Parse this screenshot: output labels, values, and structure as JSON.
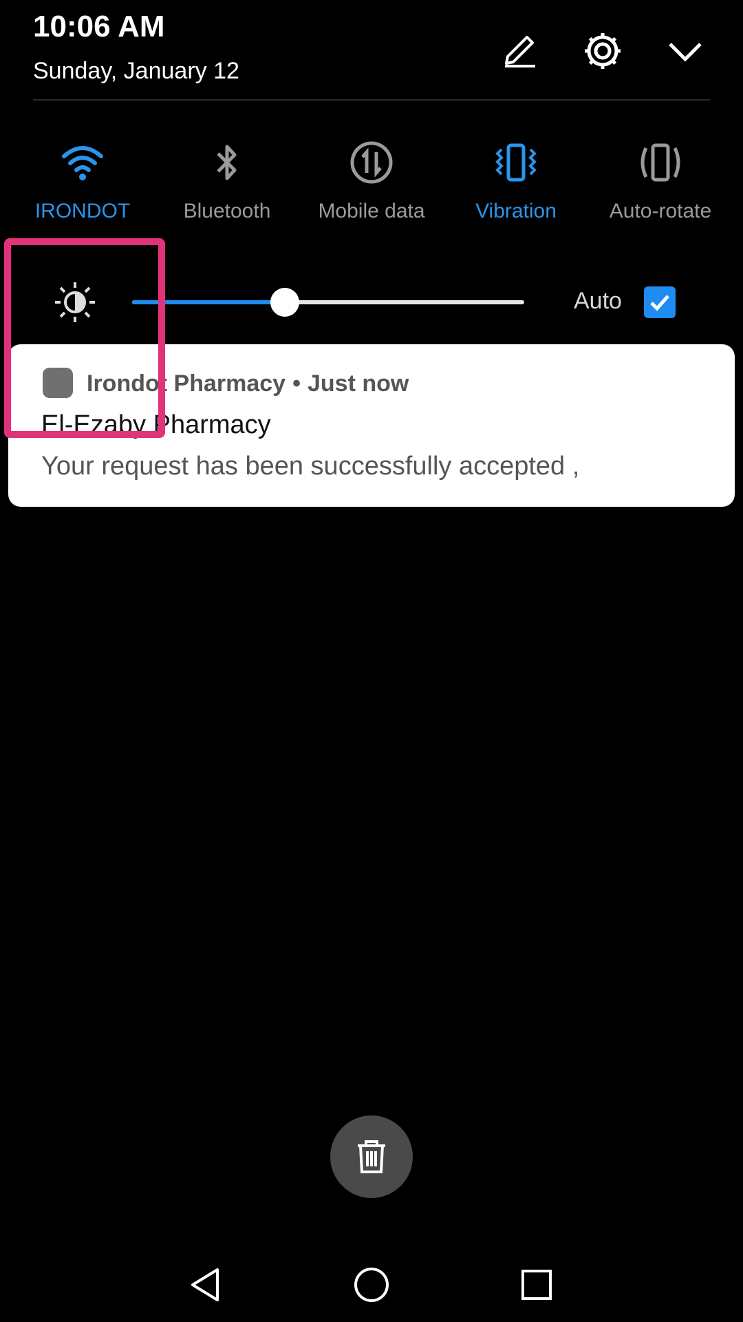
{
  "status": {
    "time": "10:06 AM",
    "date": "Sunday, January 12"
  },
  "header_icons": [
    "edit-icon",
    "gear-icon",
    "chevron-down-icon"
  ],
  "toggles": [
    {
      "label": "IRONDOT",
      "icon": "wifi-icon",
      "active": true
    },
    {
      "label": "Bluetooth",
      "icon": "bluetooth-icon",
      "active": false
    },
    {
      "label": "Mobile data",
      "icon": "mobile-data-icon",
      "active": false
    },
    {
      "label": "Vibration",
      "icon": "vibration-icon",
      "active": true
    },
    {
      "label": "Auto-rotate",
      "icon": "auto-rotate-icon",
      "active": false
    }
  ],
  "brightness": {
    "level_fraction": 0.39,
    "auto_label": "Auto",
    "auto_checked": true
  },
  "notification": {
    "app_name": "Irondot Pharmacy",
    "separator": "•",
    "time": "Just now",
    "title": "El-Ezaby Pharmacy",
    "body": "Your request has been successfully accepted ,"
  },
  "colors": {
    "accent": "#1e8cf0",
    "highlight": "#e1327c",
    "inactive": "#9a9a9a"
  }
}
